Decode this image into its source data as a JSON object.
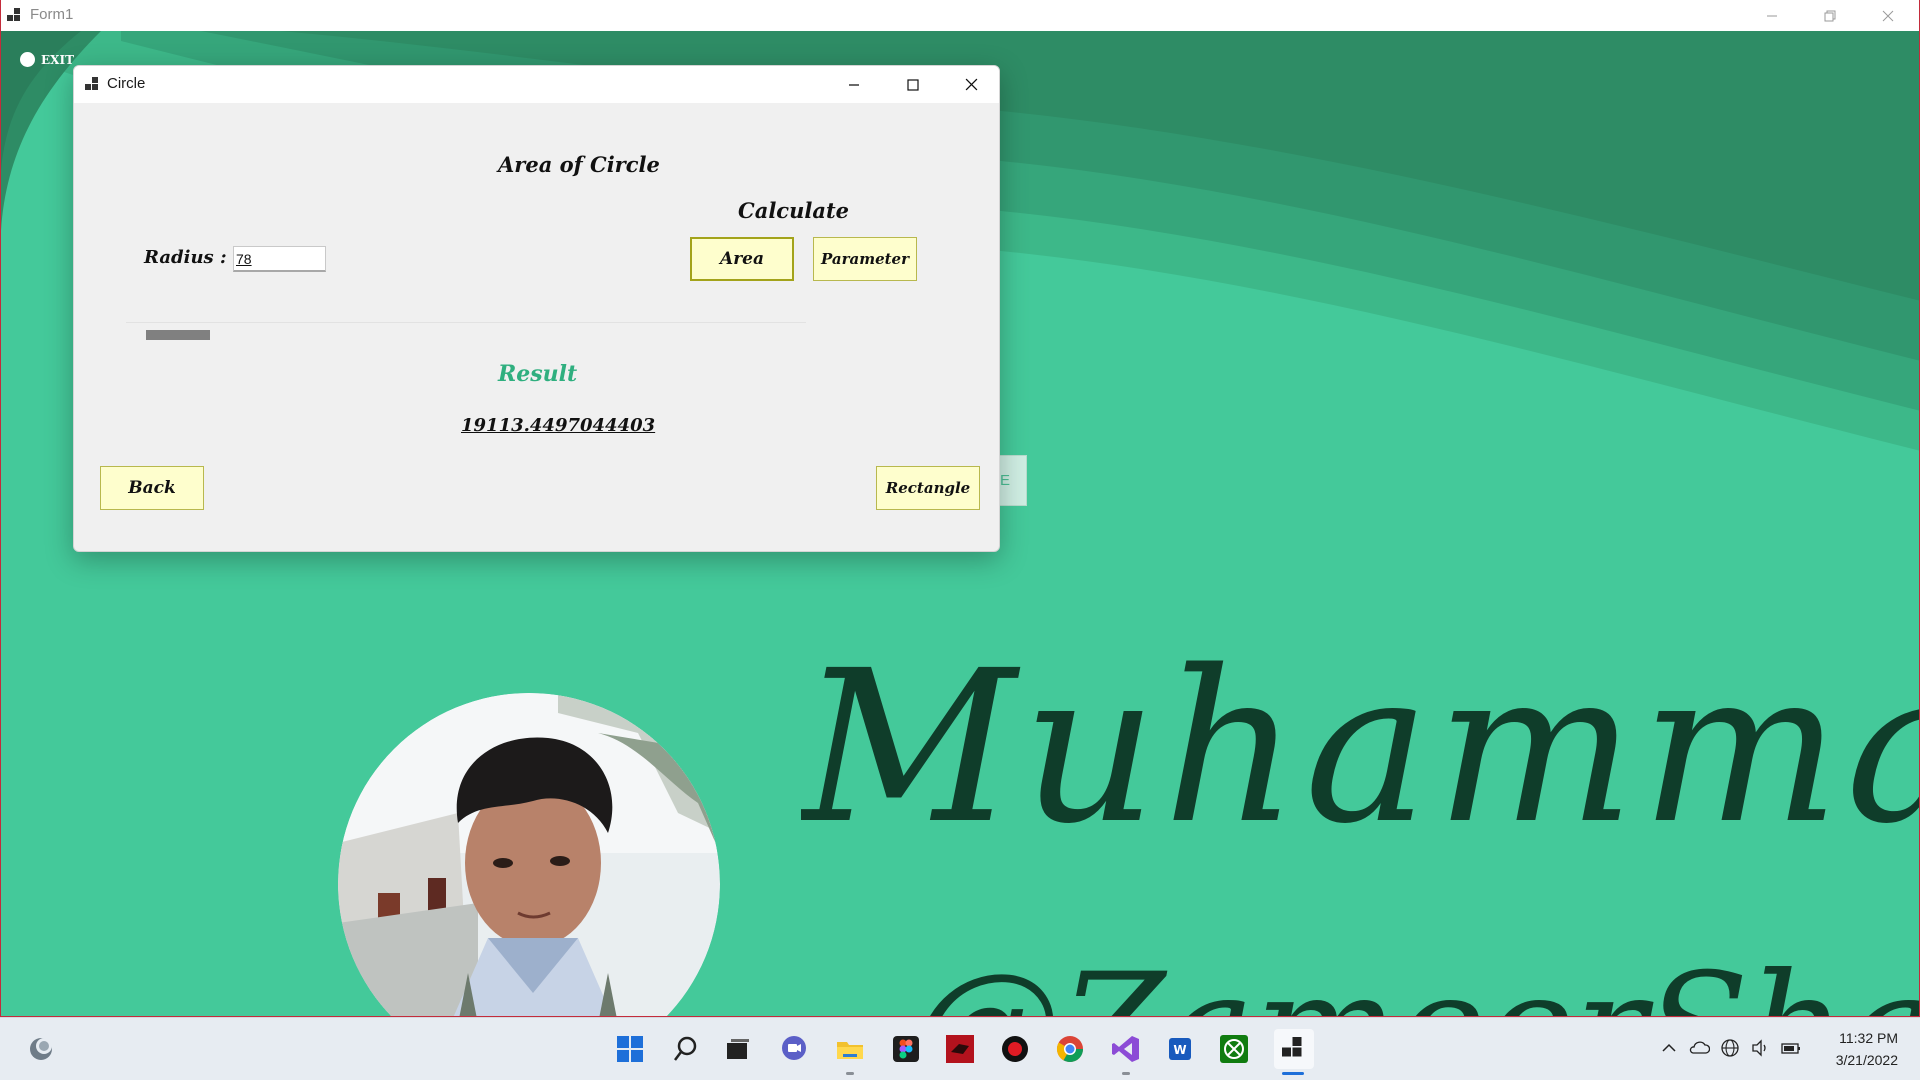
{
  "form1": {
    "title": "Form1",
    "minimize_icon": "minimize-icon",
    "restore_icon": "restore-icon",
    "close_icon": "close-icon",
    "exit_label": "EXIT",
    "peek_button_char": "E",
    "signature_name": "Muhammad R",
    "signature_handle": "@ZameerShaikh",
    "colors": {
      "background": "#44c99a",
      "dark_band": "#2e8c65",
      "signature": "#0f3d2a"
    }
  },
  "circle_window": {
    "title": "Circle",
    "heading": "Area of Circle",
    "calculate_label": "Calculate",
    "radius_label": "Radius :",
    "radius_value": "78",
    "area_button": "Area",
    "parameter_button": "Parameter",
    "result_label": "Result",
    "result_value": "19113.4497044403",
    "back_button": "Back",
    "rectangle_button": "Rectangle",
    "progress_fraction": 1.0,
    "colors": {
      "button_bg": "#fefecd",
      "result_label": "#2faf7f"
    }
  },
  "taskbar": {
    "icons": [
      "start-icon",
      "search-icon",
      "task-view-icon",
      "teams-chat-icon",
      "file-explorer-icon",
      "figma-icon",
      "filezilla-icon",
      "obs-record-icon",
      "chrome-icon",
      "visual-studio-icon",
      "word-icon",
      "xbox-icon",
      "form-app-icon"
    ],
    "clock_time": "11:32 PM",
    "clock_date": "3/21/2022"
  }
}
